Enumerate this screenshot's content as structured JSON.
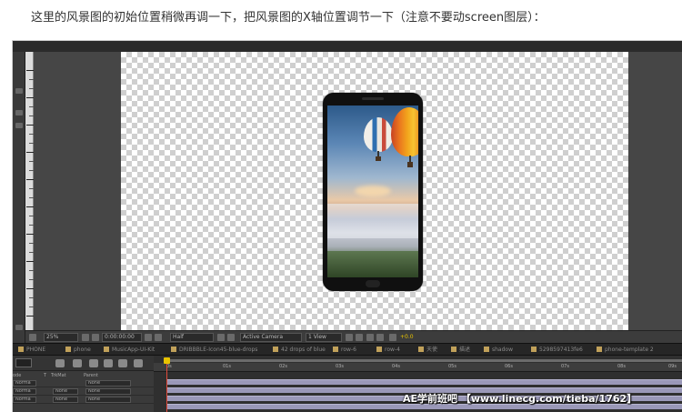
{
  "caption": "这里的风景图的初始位置稍微再调一下，把风景图的X轴位置调节一下（注意不要动screen图层）：",
  "viewer_toolbar": {
    "zoom": "25%",
    "timecode": "0:00:00:00",
    "resolution": "Half",
    "camera": "Active Camera",
    "view": "1 View",
    "exposure": "+0.0"
  },
  "tabs": [
    "PHONE",
    "phone",
    "MusicApp-UI-Kit",
    "DRIBBBLE-Icon45-blue-drops",
    "42 drops of blue",
    "row-6",
    "row-4",
    "天使",
    "描述",
    "shadow",
    "5298597413fe6",
    "phone-template 2"
  ],
  "timeline": {
    "columns": {
      "solo": "T",
      "trkmat": "TrkMat",
      "parent": "Parent"
    },
    "rows": [
      {
        "mode": "Norma",
        "trkmat": "",
        "parent": "None"
      },
      {
        "mode": "Norma",
        "trkmat": "None",
        "parent": "None"
      },
      {
        "mode": "Norma",
        "trkmat": "None",
        "parent": "None"
      }
    ],
    "ruler_ticks": [
      "0s",
      "01s",
      "02s",
      "03s",
      "04s",
      "05s",
      "06s",
      "07s",
      "08s",
      "09s",
      "10s"
    ]
  },
  "watermark": "AE学前班吧 【www.linecg.com/tieba/1762】",
  "colors": {
    "accent": "#e8c300",
    "playhead": "#e04a3a",
    "layer_bar": "#9a98b8"
  }
}
